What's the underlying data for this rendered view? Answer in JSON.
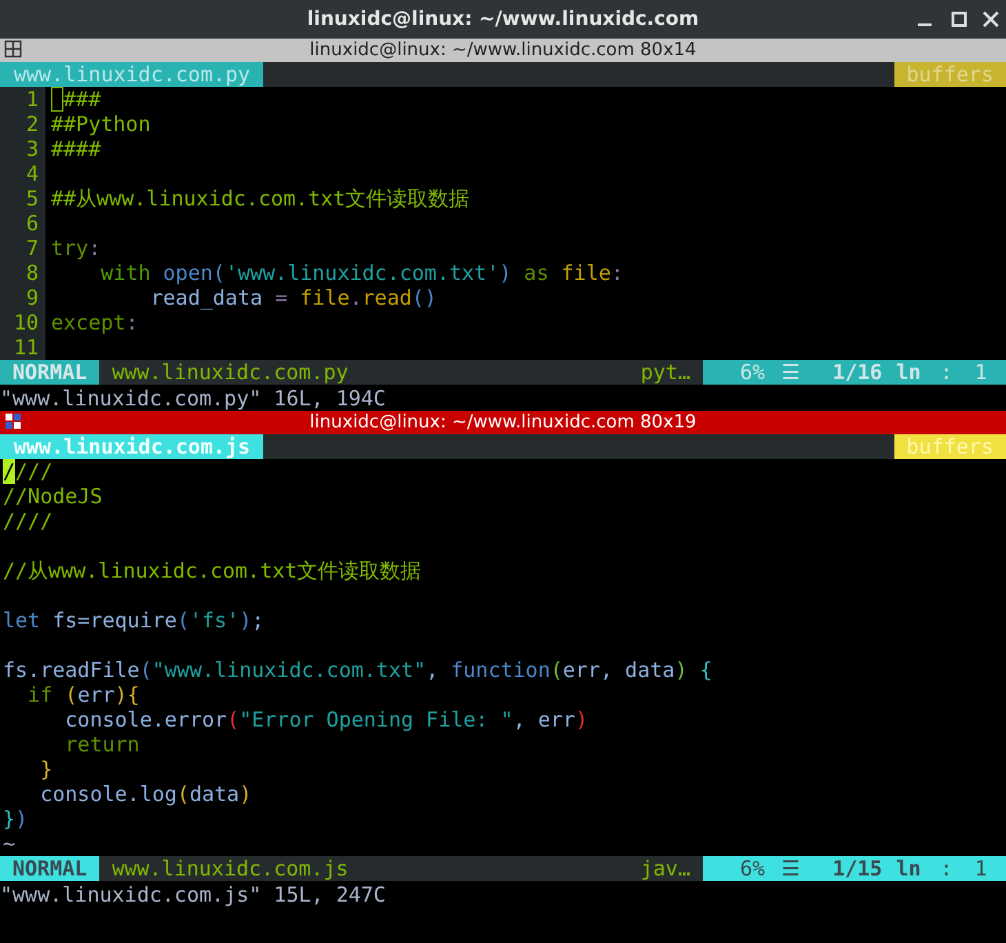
{
  "window": {
    "title": "linuxidc@linux: ~/www.linuxidc.com"
  },
  "panes": [
    {
      "title": "linuxidc@linux: ~/www.linuxidc.com 80x14",
      "active": false,
      "tab": "www.linuxidc.com.py",
      "buffers": "buffers",
      "lines": [
        {
          "kind": "code",
          "number": "1",
          "cursor": true,
          "tokens": [
            {
              "kind": "comment",
              "text": "####"
            }
          ]
        },
        {
          "kind": "code",
          "number": "2",
          "cursor": false,
          "tokens": [
            {
              "kind": "comment",
              "text": "##Python"
            }
          ]
        },
        {
          "kind": "code",
          "number": "3",
          "cursor": false,
          "tokens": [
            {
              "kind": "comment",
              "text": "####"
            }
          ]
        },
        {
          "kind": "blank",
          "number": "4",
          "cursor": false
        },
        {
          "kind": "code",
          "number": "5",
          "cursor": false,
          "tokens": [
            {
              "kind": "comment",
              "text": "##从www.linuxidc.com.txt文件读取数据"
            }
          ]
        },
        {
          "kind": "blank",
          "number": "6",
          "cursor": false
        },
        {
          "kind": "code",
          "number": "7",
          "cursor": false,
          "tokens": [
            {
              "kind": "keyword",
              "text": "try"
            },
            {
              "kind": "operator",
              "text": ":"
            }
          ]
        },
        {
          "kind": "code",
          "number": "8",
          "cursor": false,
          "tokens": [
            {
              "kind": "statement",
              "text": "    with "
            },
            {
              "kind": "builtin",
              "text": "open"
            },
            {
              "kind": "paren-blue",
              "text": "("
            },
            {
              "kind": "string",
              "text": "'www.linuxidc.com.txt'"
            },
            {
              "kind": "paren-blue",
              "text": ")"
            },
            {
              "kind": "keyword",
              "text": " as "
            },
            {
              "kind": "field",
              "text": "file"
            },
            {
              "kind": "operator",
              "text": ":"
            }
          ]
        },
        {
          "kind": "code",
          "number": "9",
          "cursor": false,
          "tokens": [
            {
              "kind": "identifier",
              "text": "        read_data "
            },
            {
              "kind": "operator",
              "text": "= "
            },
            {
              "kind": "field",
              "text": "file"
            },
            {
              "kind": "operator",
              "text": "."
            },
            {
              "kind": "field",
              "text": "read"
            },
            {
              "kind": "paren-blue",
              "text": "()"
            }
          ]
        },
        {
          "kind": "code",
          "number": "10",
          "cursor": false,
          "tokens": [
            {
              "kind": "keyword",
              "text": "except"
            },
            {
              "kind": "operator",
              "text": ":"
            }
          ]
        },
        {
          "kind": "blank",
          "number": "11",
          "cursor": false
        }
      ],
      "status": {
        "mode": "NORMAL",
        "file": "www.linuxidc.com.py",
        "filetype": "pyt…",
        "percent": "6%",
        "menu": "☰",
        "position": "1/16",
        "ln": "ln",
        "separator": ":",
        "column": "1"
      },
      "message": "\"www.linuxidc.com.py\" 16L, 194C"
    },
    {
      "title": "linuxidc@linux: ~/www.linuxidc.com 80x19",
      "active": true,
      "tab": "www.linuxidc.com.js",
      "buffers": "buffers",
      "lines": [
        {
          "kind": "code",
          "cursor": true,
          "tokens": [
            {
              "kind": "comment",
              "text": "////"
            }
          ]
        },
        {
          "kind": "code",
          "cursor": false,
          "tokens": [
            {
              "kind": "comment",
              "text": "//NodeJS"
            }
          ]
        },
        {
          "kind": "code",
          "cursor": false,
          "tokens": [
            {
              "kind": "comment",
              "text": "////"
            }
          ]
        },
        {
          "kind": "blank",
          "cursor": false
        },
        {
          "kind": "code",
          "cursor": false,
          "tokens": [
            {
              "kind": "comment",
              "text": "//从www.linuxidc.com.txt文件读取数据"
            }
          ]
        },
        {
          "kind": "blank",
          "cursor": false
        },
        {
          "kind": "code",
          "cursor": false,
          "tokens": [
            {
              "kind": "builtin",
              "text": "let "
            },
            {
              "kind": "identifier",
              "text": "fs=require"
            },
            {
              "kind": "paren-blue",
              "text": "("
            },
            {
              "kind": "string",
              "text": "'fs'"
            },
            {
              "kind": "paren-blue",
              "text": ")"
            },
            {
              "kind": "identifier",
              "text": ";"
            }
          ]
        },
        {
          "kind": "blank",
          "cursor": false
        },
        {
          "kind": "code",
          "cursor": false,
          "tokens": [
            {
              "kind": "identifier",
              "text": "fs.readFile"
            },
            {
              "kind": "paren-blue",
              "text": "("
            },
            {
              "kind": "string",
              "text": "\"www.linuxidc.com.txt\""
            },
            {
              "kind": "identifier",
              "text": ", "
            },
            {
              "kind": "builtin",
              "text": "function"
            },
            {
              "kind": "paren-green",
              "text": "("
            },
            {
              "kind": "identifier",
              "text": "err, data"
            },
            {
              "kind": "paren-green",
              "text": ")"
            },
            {
              "kind": "paren-cyan",
              "text": " {"
            }
          ]
        },
        {
          "kind": "code",
          "cursor": false,
          "tokens": [
            {
              "kind": "keyword",
              "text": "  if "
            },
            {
              "kind": "paren-yellow",
              "text": "("
            },
            {
              "kind": "identifier",
              "text": "err"
            },
            {
              "kind": "paren-yellow",
              "text": "){"
            }
          ]
        },
        {
          "kind": "code",
          "cursor": false,
          "tokens": [
            {
              "kind": "identifier",
              "text": "     console.error"
            },
            {
              "kind": "paren-red",
              "text": "("
            },
            {
              "kind": "string",
              "text": "\"Error Opening File: \""
            },
            {
              "kind": "identifier",
              "text": ", err"
            },
            {
              "kind": "paren-red",
              "text": ")"
            }
          ]
        },
        {
          "kind": "code",
          "cursor": false,
          "tokens": [
            {
              "kind": "keyword",
              "text": "     return"
            }
          ]
        },
        {
          "kind": "code",
          "cursor": false,
          "tokens": [
            {
              "kind": "paren-yellow",
              "text": "   }"
            }
          ]
        },
        {
          "kind": "code",
          "cursor": false,
          "tokens": [
            {
              "kind": "identifier",
              "text": "   console.log"
            },
            {
              "kind": "paren-yellow",
              "text": "("
            },
            {
              "kind": "identifier",
              "text": "data"
            },
            {
              "kind": "paren-yellow",
              "text": ")"
            }
          ]
        },
        {
          "kind": "code",
          "cursor": false,
          "tokens": [
            {
              "kind": "paren-cyan",
              "text": "}"
            },
            {
              "kind": "paren-blue",
              "text": ")"
            }
          ]
        },
        {
          "kind": "tilde",
          "cursor": false,
          "tokens": [
            {
              "kind": "tilde",
              "text": "~"
            }
          ]
        }
      ],
      "status": {
        "mode": "NORMAL",
        "file": "www.linuxidc.com.js",
        "filetype": "jav…",
        "percent": "6%",
        "menu": "☰",
        "position": "1/15",
        "ln": "ln",
        "separator": ":",
        "column": "1"
      },
      "message": "\"www.linuxidc.com.js\" 15L, 247C"
    }
  ]
}
